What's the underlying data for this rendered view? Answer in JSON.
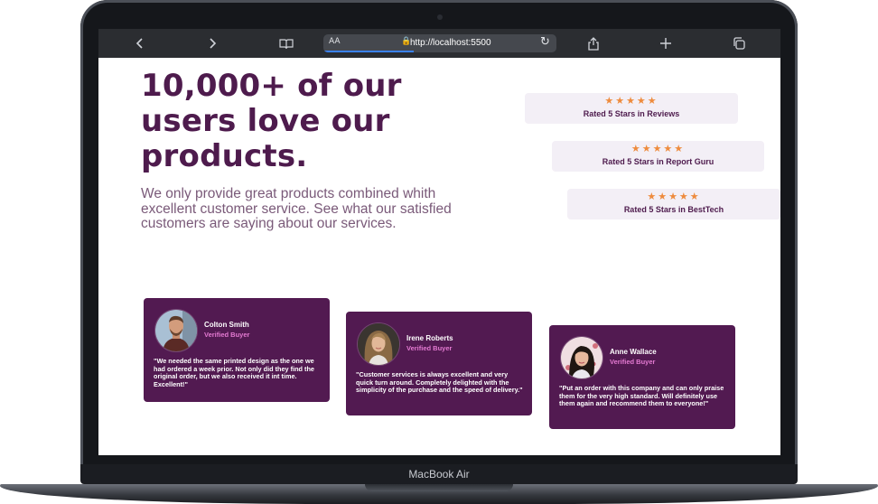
{
  "device": {
    "base_label": "MacBook Air"
  },
  "browser": {
    "back_icon": "chevron-left-icon",
    "forward_icon": "chevron-right-icon",
    "bookmarks_icon": "book-icon",
    "reader_label": "AA",
    "url": "http://localhost:5500",
    "reload_icon": "reload-icon",
    "share_icon": "share-icon",
    "new_tab_icon": "plus-icon",
    "tabs_icon": "tabs-icon"
  },
  "hero": {
    "headline": "10,000+ of our users love our products.",
    "subtext": "We only provide great products combined whith excellent customer service. See what our satisfied customers are saying about our services."
  },
  "ratings": [
    {
      "stars": "★★★★★",
      "label": "Rated 5 Stars in Reviews"
    },
    {
      "stars": "★★★★★",
      "label": "Rated 5 Stars in Report Guru"
    },
    {
      "stars": "★★★★★",
      "label": "Rated 5 Stars in BestTech"
    }
  ],
  "testimonials": [
    {
      "name": "Colton Smith",
      "role": "Verified Buyer",
      "quote": "\"We needed the same printed design as the one we had ordered a week prior. Not only did they find the original order, but we also received it int time. Excellent!\""
    },
    {
      "name": "Irene Roberts",
      "role": "Verified Buyer",
      "quote": "\"Customer services is always excellent and very quick turn around. Completely delighted with the simplicity of the purchase and the speed of delivery.\""
    },
    {
      "name": "Anne Wallace",
      "role": "Verified Buyer",
      "quote": "\"Put an order with this company and can only praise them for the very high standard. Will definitely use them again and recommend them to everyone!\""
    }
  ],
  "colors": {
    "brand": "#4e1b4d",
    "card": "#521a51",
    "accent_pink": "#e47ad2",
    "star": "#ee8b3d",
    "rating_bg": "#f3eff6"
  }
}
